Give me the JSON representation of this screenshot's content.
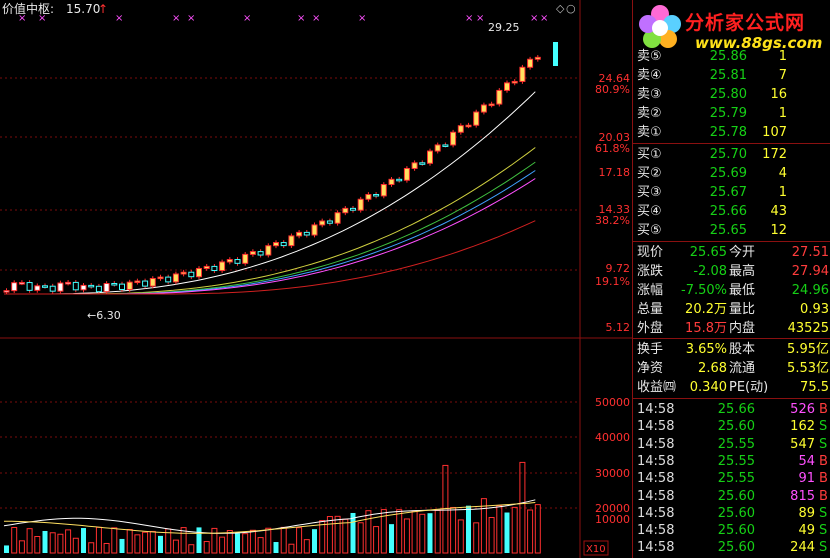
{
  "chart": {
    "indicator_label": "价值中枢:",
    "indicator_value": "15.70",
    "indicator_arrow": "↑",
    "high_label": "29.25",
    "low_label": "←6.30",
    "price_ticks": [
      "24.64",
      "80.9%",
      "20.03",
      "61.8%",
      "17.18",
      "14.33",
      "38.2%",
      "9.72",
      "19.1%",
      "5.12"
    ],
    "volume_ticks": [
      "50000",
      "40000",
      "30000",
      "20000",
      "10000"
    ],
    "volume_scale": "X10",
    "colors": {
      "up": "#ff3030",
      "down": "#4ff",
      "yellow": "#ffe060",
      "grid": "#7a0c0c"
    }
  },
  "logo": {
    "title": "分析家公式网",
    "url": "www.88gs.com"
  },
  "orderbook": {
    "asks": [
      {
        "label": "卖⑤",
        "price": "25.86",
        "vol": "1"
      },
      {
        "label": "卖④",
        "price": "25.81",
        "vol": "7"
      },
      {
        "label": "卖③",
        "price": "25.80",
        "vol": "16"
      },
      {
        "label": "卖②",
        "price": "25.79",
        "vol": "1"
      },
      {
        "label": "卖①",
        "price": "25.78",
        "vol": "107"
      }
    ],
    "bids": [
      {
        "label": "买①",
        "price": "25.70",
        "vol": "172"
      },
      {
        "label": "买②",
        "price": "25.69",
        "vol": "4"
      },
      {
        "label": "买③",
        "price": "25.67",
        "vol": "1"
      },
      {
        "label": "买④",
        "price": "25.66",
        "vol": "43"
      },
      {
        "label": "买⑤",
        "price": "25.65",
        "vol": "12"
      }
    ]
  },
  "quote": [
    {
      "l1": "现价",
      "v1": "25.65",
      "l2": "今开",
      "v2": "27.51"
    },
    {
      "l1": "涨跌",
      "v1": "-2.08",
      "l2": "最高",
      "v2": "27.94"
    },
    {
      "l1": "涨幅",
      "v1": "-7.50%",
      "l2": "最低",
      "v2": "24.96"
    },
    {
      "l1": "总量",
      "v1": "20.2万",
      "l2": "量比",
      "v2": "0.93"
    },
    {
      "l1": "外盘",
      "v1": "15.8万",
      "l2": "内盘",
      "v2": "43525"
    }
  ],
  "fundamentals": [
    {
      "l1": "换手",
      "v1": "3.65%",
      "l2": "股本",
      "v2": "5.95亿"
    },
    {
      "l1": "净资",
      "v1": "2.68",
      "l2": "流通",
      "v2": "5.53亿"
    },
    {
      "l1": "收益㈣",
      "v1": "0.340",
      "l2": "PE(动)",
      "v2": "75.5"
    }
  ],
  "ticks": [
    {
      "time": "14:58",
      "price": "25.66",
      "vol": "526",
      "side": "B"
    },
    {
      "time": "14:58",
      "price": "25.60",
      "vol": "162",
      "side": "S"
    },
    {
      "time": "14:58",
      "price": "25.55",
      "vol": "547",
      "side": "S"
    },
    {
      "time": "14:58",
      "price": "25.55",
      "vol": "54",
      "side": "B"
    },
    {
      "time": "14:58",
      "price": "25.55",
      "vol": "91",
      "side": "B"
    },
    {
      "time": "14:58",
      "price": "25.60",
      "vol": "815",
      "side": "B"
    },
    {
      "time": "14:58",
      "price": "25.60",
      "vol": "89",
      "side": "S"
    },
    {
      "time": "14:58",
      "price": "25.60",
      "vol": "49",
      "side": "S"
    },
    {
      "time": "14:58",
      "price": "25.60",
      "vol": "244",
      "side": "S"
    }
  ]
}
